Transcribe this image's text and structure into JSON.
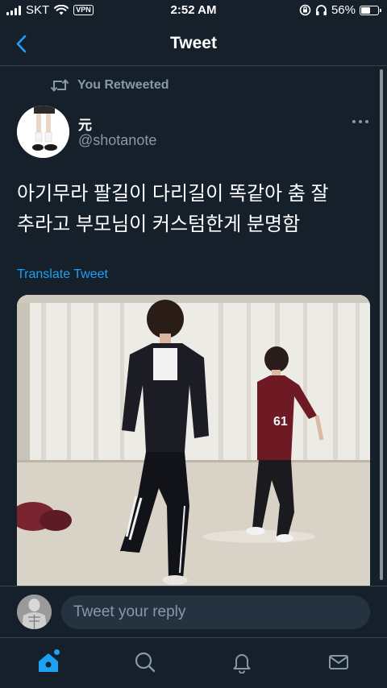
{
  "status_bar": {
    "carrier": "SKT",
    "vpn": "VPN",
    "time": "2:52 AM",
    "battery": "56%",
    "battery_level": 0.56
  },
  "header": {
    "title": "Tweet"
  },
  "tweet": {
    "retweet_label": "You Retweeted",
    "author_name": "元",
    "author_handle": "@shotanote",
    "text_line1": "아기무라 팔길이 다리길이 똑같아 춤 잘",
    "text_line2": "추라고 부모님이 커스텀한게 분명함",
    "translate_label": "Translate Tweet"
  },
  "reply": {
    "placeholder": "Tweet your reply"
  },
  "tabs": [
    {
      "icon": "home-icon",
      "active": true
    },
    {
      "icon": "search-icon",
      "active": false
    },
    {
      "icon": "bell-icon",
      "active": false
    },
    {
      "icon": "mail-icon",
      "active": false
    }
  ],
  "colors": {
    "background": "#15202b",
    "accent": "#1da1f2",
    "secondary_text": "#8899a6",
    "divider": "#38444d"
  }
}
